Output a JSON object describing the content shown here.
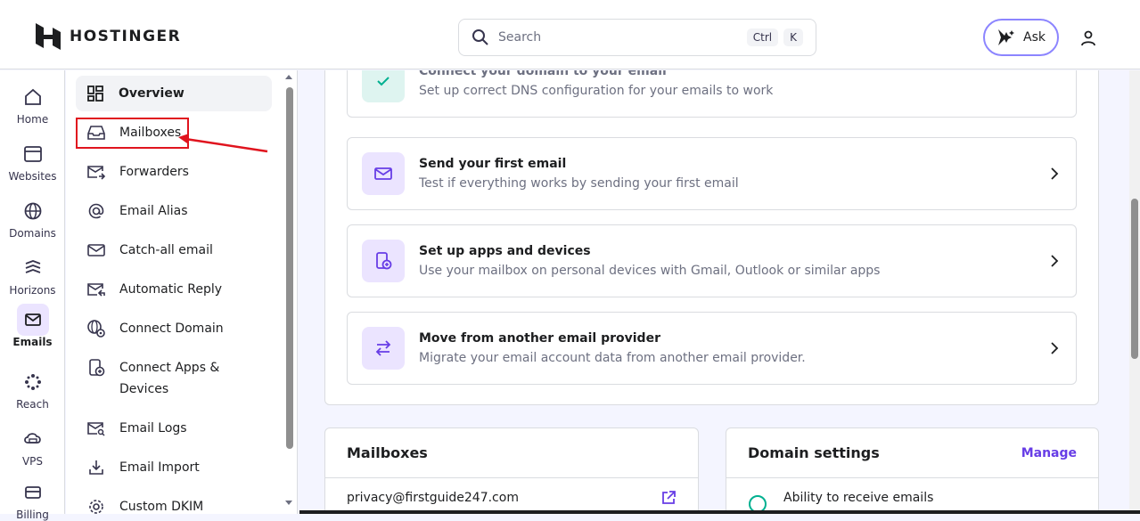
{
  "header": {
    "logo_text": "HOSTINGER",
    "search_placeholder": "Search",
    "kbd_ctrl": "Ctrl",
    "kbd_k": "K",
    "ask_label": "Ask"
  },
  "rail": [
    {
      "label": "Home",
      "icon": "home-icon"
    },
    {
      "label": "Websites",
      "icon": "browser-icon"
    },
    {
      "label": "Domains",
      "icon": "globe-icon"
    },
    {
      "label": "Horizons",
      "icon": "horizons-icon"
    },
    {
      "label": "Emails",
      "icon": "mail-icon",
      "active": true
    },
    {
      "label": "Reach",
      "icon": "reach-icon"
    },
    {
      "label": "VPS",
      "icon": "cloud-server-icon"
    },
    {
      "label": "Billing",
      "icon": "card-icon"
    }
  ],
  "subnav": [
    {
      "label": "Overview",
      "icon": "dashboard-icon",
      "active": true
    },
    {
      "label": "Mailboxes",
      "icon": "inbox-icon",
      "highlighted": true
    },
    {
      "label": "Forwarders",
      "icon": "forward-mail-icon"
    },
    {
      "label": "Email Alias",
      "icon": "at-icon"
    },
    {
      "label": "Catch-all email",
      "icon": "mail-outline-icon"
    },
    {
      "label": "Automatic Reply",
      "icon": "auto-reply-icon"
    },
    {
      "label": "Connect Domain",
      "icon": "globe-settings-icon"
    },
    {
      "label": "Connect Apps & Devices",
      "icon": "device-add-icon"
    },
    {
      "label": "Email Logs",
      "icon": "mail-search-icon"
    },
    {
      "label": "Email Import",
      "icon": "download-icon"
    },
    {
      "label": "Custom DKIM",
      "icon": "gear-icon"
    }
  ],
  "steps": [
    {
      "title": "Connect your domain to your email",
      "desc": "Set up correct DNS configuration for your emails to work",
      "done": true
    },
    {
      "title": "Send your first email",
      "desc": "Test if everything works by sending your first email"
    },
    {
      "title": "Set up apps and devices",
      "desc": "Use your mailbox on personal devices with Gmail, Outlook or similar apps"
    },
    {
      "title": "Move from another email provider",
      "desc": "Migrate your email account data from another email provider."
    }
  ],
  "mailboxes_card": {
    "title": "Mailboxes",
    "email": "privacy@firstguide247.com"
  },
  "domain_card": {
    "title": "Domain settings",
    "manage": "Manage",
    "item": "Ability to receive emails"
  },
  "colors": {
    "accent": "#673de6",
    "annotation_red": "#e0141e",
    "success_bg": "#def4f0"
  }
}
